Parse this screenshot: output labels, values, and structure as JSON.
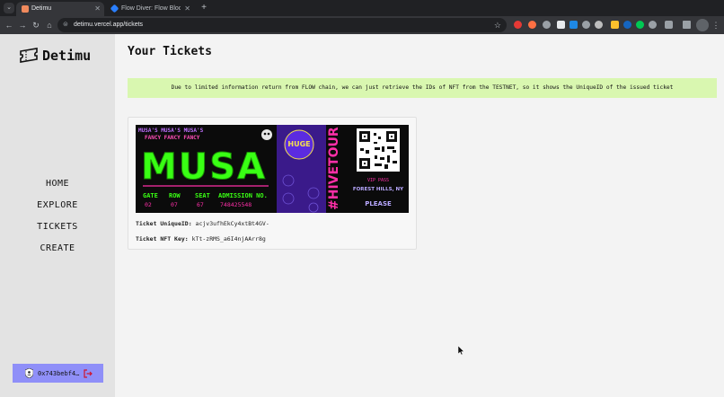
{
  "browser": {
    "tabs": [
      {
        "title": "Detimu",
        "active": true
      },
      {
        "title": "Flow Diver: Flow Blockchain",
        "active": false
      }
    ],
    "url": "detimu.vercel.app/tickets"
  },
  "app": {
    "brand": "Detimu",
    "nav": [
      "HOME",
      "EXPLORE",
      "TICKETS",
      "CREATE"
    ],
    "wallet_address": "0x743bebf4…"
  },
  "main": {
    "title": "Your Tickets",
    "notice": "Due to limited information return from FLOW chain, we can just retrieve the IDs of NFT from the TESTNET, so it shows the UniqueID of the issued ticket",
    "tickets": [
      {
        "unique_id_label": "Ticket UniqueID:",
        "unique_id": "acjv3ufhEkCy4xtBt4GV-",
        "nft_key_label": "Ticket NFT Key:",
        "nft_key": "kTt-zRMS_a6I4njAArr8g"
      }
    ]
  },
  "ticket_art": {
    "header_text": "MUSA'S MUSA'S MUSA'S",
    "sub_text": "FANCY FANCY FANCY",
    "big_text": "MUSA",
    "labels": [
      "GATE",
      "ROW",
      "SEAT",
      "ADMISSION NO."
    ],
    "values": [
      "02",
      "07",
      "67",
      "748425548"
    ],
    "badge": "HUGE",
    "vertical_text": "#HIVETOUR",
    "vip": "VIP PASS",
    "location": "FOREST HILLS, NY",
    "please": "PLEASE",
    "colors": {
      "green": "#39ff14",
      "purple": "#7b2ff7",
      "pink": "#ff2fa8",
      "yellow": "#f4e04d",
      "lavender": "#b8a8ff"
    }
  }
}
